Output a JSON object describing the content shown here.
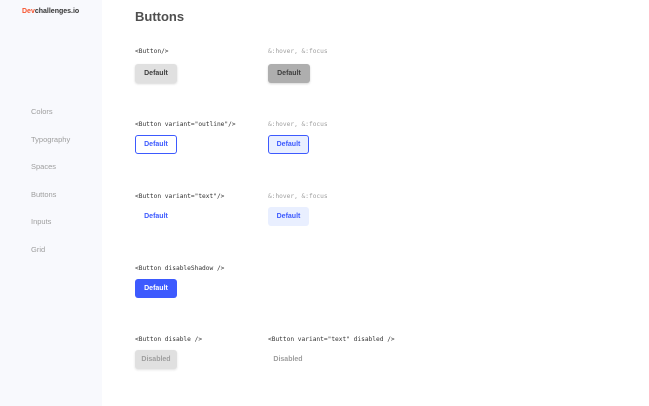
{
  "sidebar": {
    "logo_brand": "Dev",
    "logo_rest": "challenges.io",
    "items": [
      {
        "label": "Colors"
      },
      {
        "label": "Typography"
      },
      {
        "label": "Spaces"
      },
      {
        "label": "Buttons"
      },
      {
        "label": "Inputs"
      },
      {
        "label": "Grid"
      }
    ]
  },
  "main": {
    "title": "Buttons",
    "sections": [
      {
        "code": "<Button/>",
        "hover_code": "&:hover, &:focus",
        "label": "Default",
        "hover_label": "Default"
      },
      {
        "code": "<Button variant=\"outline\"/>",
        "hover_code": "&:hover, &:focus",
        "label": "Default",
        "hover_label": "Default"
      },
      {
        "code": "<Button variant=\"text\"/>",
        "hover_code": "&:hover, &:focus",
        "label": "Default",
        "hover_label": "Default"
      },
      {
        "code": "<Button disableShadow />",
        "label": "Default"
      },
      {
        "code": "<Button disable />",
        "alt_code": "<Button variant=\"text\" disabled />",
        "label": "Disabled",
        "alt_label": "Disabled"
      }
    ]
  },
  "colors": {
    "primary": "#3d5afe",
    "brand": "#f7542e",
    "default_bg": "#e0e0e0",
    "hover_bg": "#aeaeae",
    "sidebar_bg": "#f8f9fd",
    "muted_text": "#9e9e9e"
  }
}
